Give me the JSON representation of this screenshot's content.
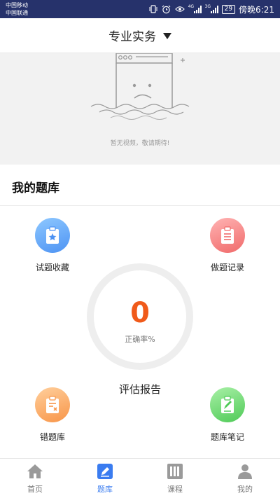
{
  "status_bar": {
    "carrier_1": "中国移动",
    "carrier_2": "中国联通",
    "network_tag_1": "4G",
    "network_tag_2": "3G",
    "battery": "29",
    "time": "傍晚6:21"
  },
  "header": {
    "title": "专业实务"
  },
  "video": {
    "empty_text": "暂无视频，敬请期待!"
  },
  "question_bank": {
    "heading": "我的题库",
    "features": [
      {
        "label": "试题收藏",
        "icon": "clipboard-star-icon",
        "color": "#4d93f3"
      },
      {
        "label": "做题记录",
        "icon": "clipboard-list-icon",
        "color": "#f06a6a"
      },
      {
        "label": "错题库",
        "icon": "clipboard-x-icon",
        "color": "#f89548"
      },
      {
        "label": "题库笔记",
        "icon": "clipboard-pen-icon",
        "color": "#4fca57"
      }
    ],
    "accuracy": {
      "value": "0",
      "label": "正确率%"
    },
    "assessment_label": "评估报告"
  },
  "bottom_nav": {
    "items": [
      {
        "label": "首页",
        "icon": "home-icon",
        "active": false
      },
      {
        "label": "题库",
        "icon": "edit-icon",
        "active": true
      },
      {
        "label": "课程",
        "icon": "books-icon",
        "active": false
      },
      {
        "label": "我的",
        "icon": "person-icon",
        "active": false
      }
    ]
  },
  "colors": {
    "status_bar": "#26326b",
    "accent": "#3a7cf0",
    "accuracy_value": "#f05a1a"
  }
}
